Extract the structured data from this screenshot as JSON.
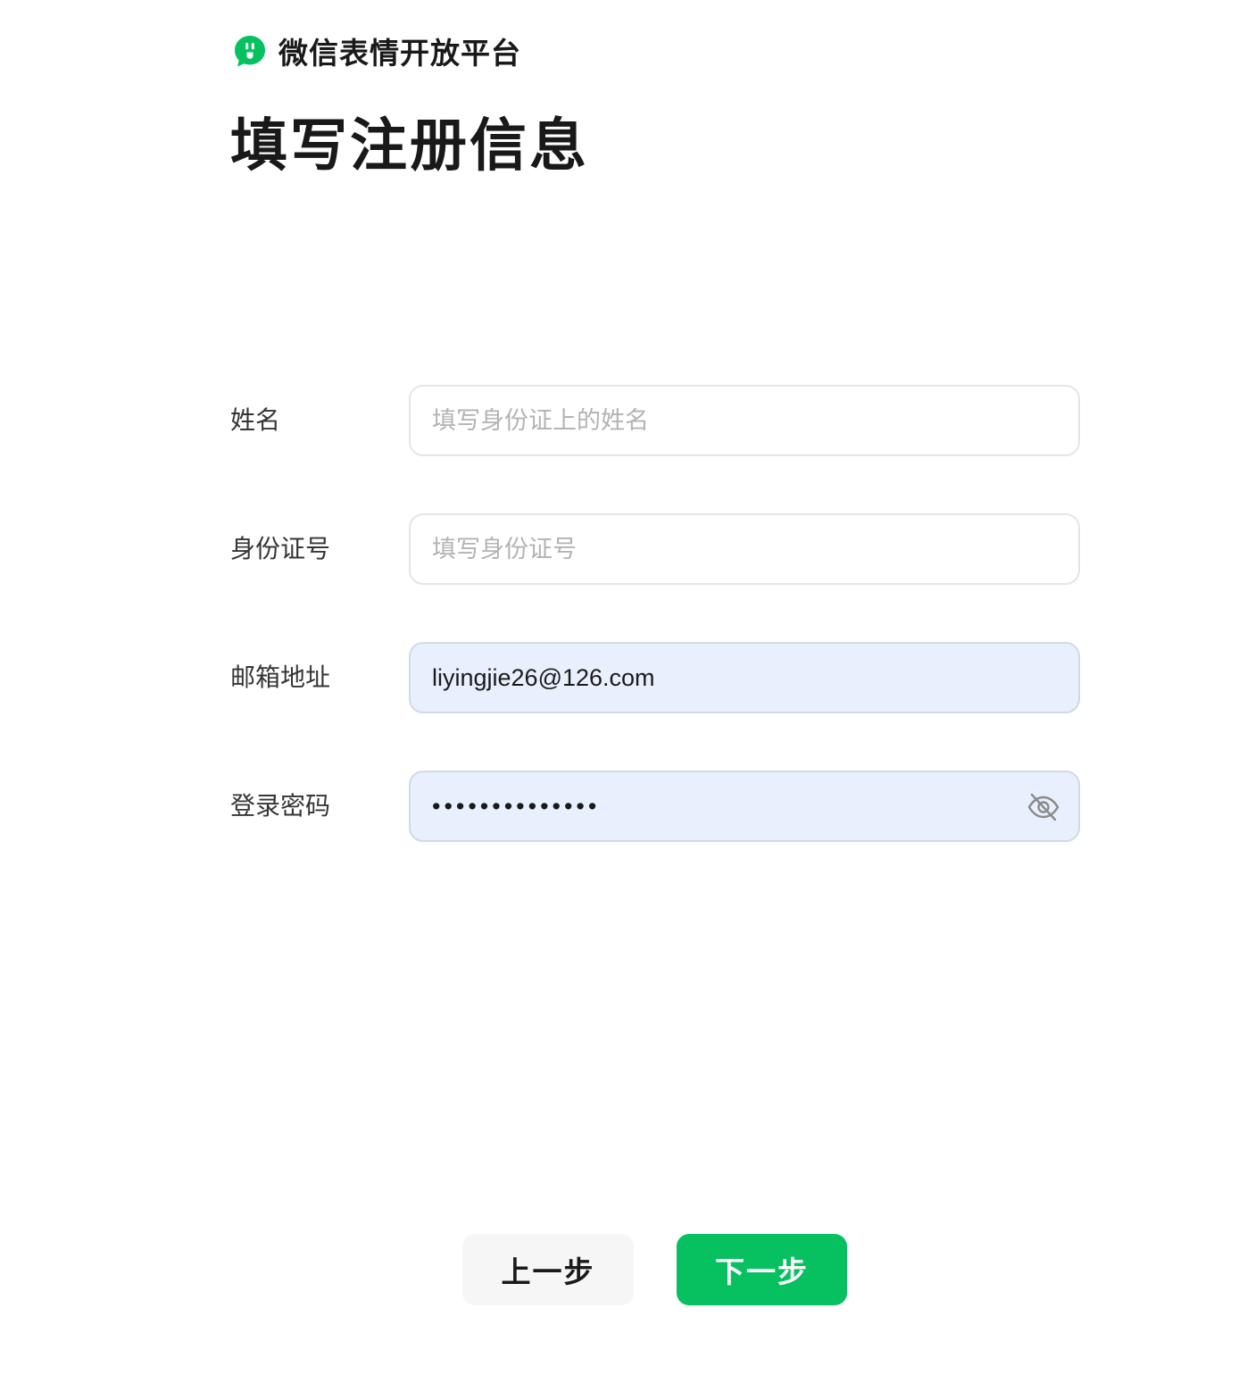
{
  "brand": {
    "name": "微信表情开放平台",
    "logo_icon": "wechat-emoji-logo-icon",
    "accent_color": "#07c160"
  },
  "page": {
    "title": "填写注册信息"
  },
  "form": {
    "name": {
      "label": "姓名",
      "placeholder": "填写身份证上的姓名",
      "value": ""
    },
    "id_number": {
      "label": "身份证号",
      "placeholder": "填写身份证号",
      "value": ""
    },
    "email": {
      "label": "邮箱地址",
      "placeholder": "",
      "value": "liyingjie26@126.com"
    },
    "password": {
      "label": "登录密码",
      "placeholder": "",
      "value": "••••••••••••••",
      "toggle_icon": "eye-off-icon"
    }
  },
  "actions": {
    "prev_label": "上一步",
    "next_label": "下一步"
  }
}
